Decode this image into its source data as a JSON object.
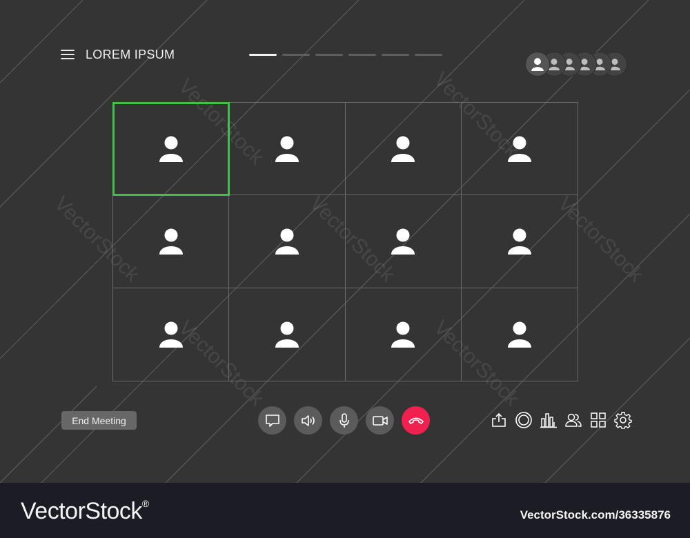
{
  "header": {
    "title": "LOREM IPSUM",
    "menu_icon": "hamburger-icon",
    "pager": {
      "pages": 6,
      "active_page": 1
    },
    "participant_count_shown": 6
  },
  "grid": {
    "tiles": 12,
    "active_speaker_index": 0,
    "avatar_icon": "user-icon"
  },
  "end_meeting": {
    "label": "End Meeting"
  },
  "controls": [
    {
      "name": "chat-button",
      "icon": "chat-bubble-icon"
    },
    {
      "name": "speaker-button",
      "icon": "speaker-icon"
    },
    {
      "name": "microphone-button",
      "icon": "microphone-icon"
    },
    {
      "name": "camera-button",
      "icon": "video-camera-icon"
    },
    {
      "name": "hang-up-button",
      "icon": "phone-hangup-icon"
    }
  ],
  "tools": [
    {
      "name": "share-button",
      "icon": "share-upload-icon"
    },
    {
      "name": "record-button",
      "icon": "record-icon"
    },
    {
      "name": "stats-button",
      "icon": "bar-chart-icon"
    },
    {
      "name": "participants-button",
      "icon": "participants-icon"
    },
    {
      "name": "layout-button",
      "icon": "grid-layout-icon"
    },
    {
      "name": "settings-button",
      "icon": "gear-icon"
    }
  ],
  "colors": {
    "background": "#343434",
    "active_speaker": "#44c04a",
    "hangup": "#f0214e"
  },
  "watermark": {
    "text": "VectorStock"
  },
  "footer": {
    "logo": "VectorStock",
    "registered": "®",
    "image_id": "VectorStock.com/36335876"
  }
}
